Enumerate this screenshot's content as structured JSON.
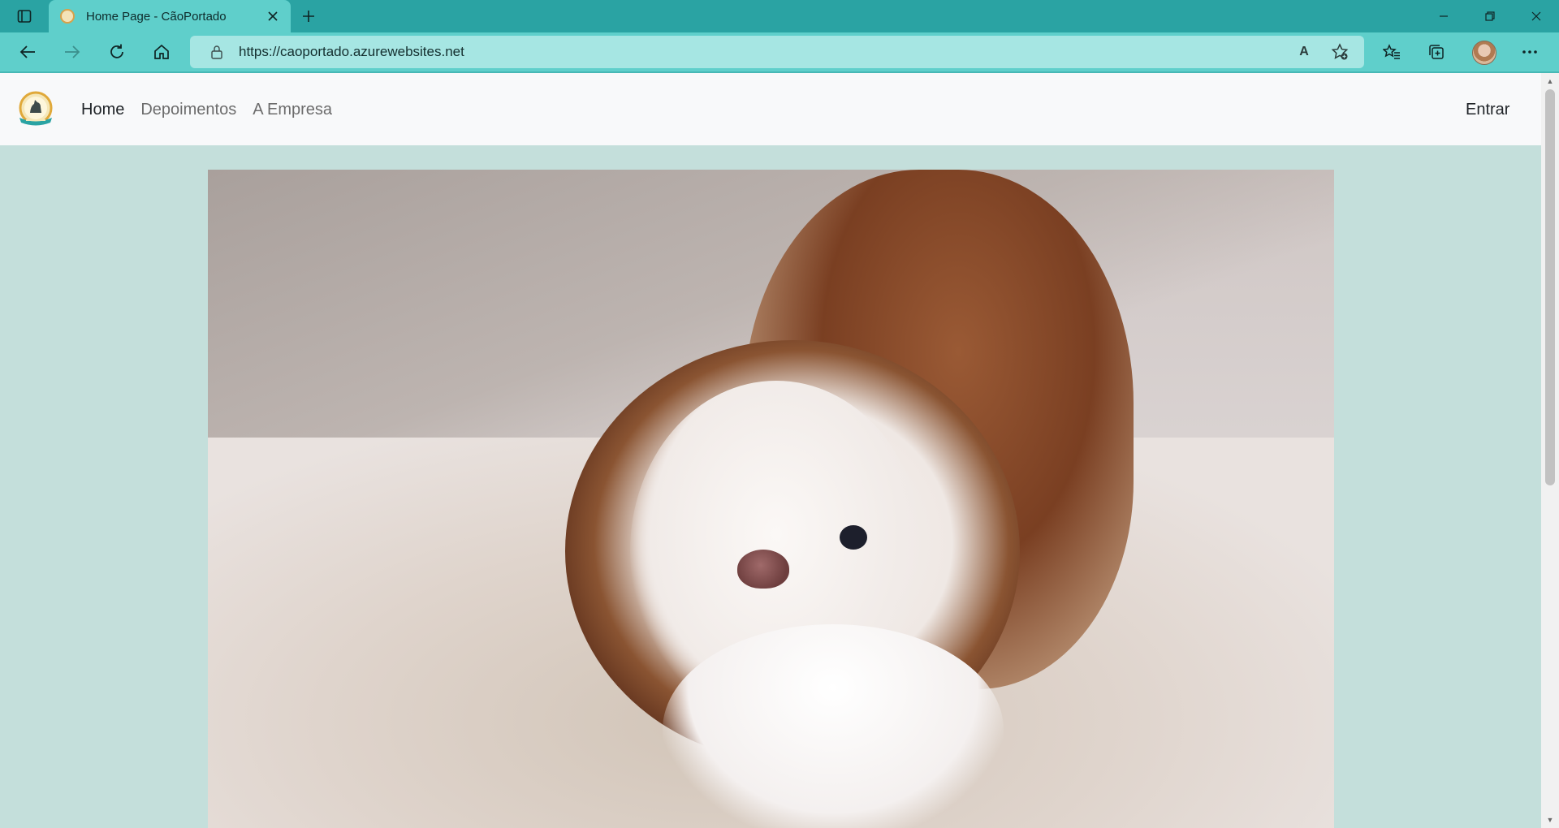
{
  "browser": {
    "tab_title": "Home Page - CãoPortado",
    "url": "https://caoportado.azurewebsites.net",
    "read_aloud_label": "A"
  },
  "site": {
    "nav": [
      {
        "label": "Home",
        "active": true
      },
      {
        "label": "Depoimentos",
        "active": false
      },
      {
        "label": "A Empresa",
        "active": false
      }
    ],
    "login_label": "Entrar"
  },
  "colors": {
    "tab_bar": "#2aa3a3",
    "toolbar": "#5fcfcb",
    "address_bar": "#a6e6e3",
    "page_background": "#c4dfdb",
    "header_background": "#f8f9fa"
  },
  "icons": [
    "tab-actions-icon",
    "close-icon",
    "plus-icon",
    "minimize-icon",
    "restore-icon",
    "close-window-icon",
    "back-arrow-icon",
    "forward-arrow-icon",
    "refresh-icon",
    "home-icon",
    "lock-icon",
    "favorite-add-icon",
    "favorites-icon",
    "collections-icon",
    "more-icon"
  ]
}
